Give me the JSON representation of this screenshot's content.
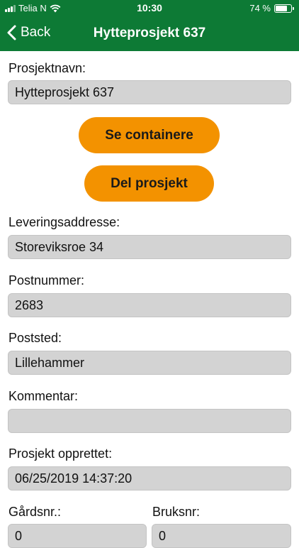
{
  "status": {
    "carrier": "Telia N",
    "time": "10:30",
    "battery": "74 %"
  },
  "nav": {
    "back_label": "Back",
    "title": "Hytteprosjekt 637"
  },
  "form": {
    "project_name_label": "Prosjektnavn:",
    "project_name_value": "Hytteprosjekt 637",
    "see_containers_button": "Se containere",
    "share_project_button": "Del prosjekt",
    "delivery_address_label": "Leveringsaddresse:",
    "delivery_address_value": "Storeviksroe 34",
    "postal_code_label": "Postnummer:",
    "postal_code_value": "2683",
    "postal_place_label": "Poststed:",
    "postal_place_value": "Lillehammer",
    "comment_label": "Kommentar:",
    "comment_value": "",
    "created_label": "Prosjekt opprettet:",
    "created_value": "06/25/2019 14:37:20",
    "farm_no_label": "Gårdsnr.:",
    "farm_no_value": "0",
    "property_no_label": "Bruksnr:",
    "property_no_value": "0"
  },
  "colors": {
    "header": "#0d7a35",
    "button": "#f39200",
    "field": "#d3d3d3"
  }
}
